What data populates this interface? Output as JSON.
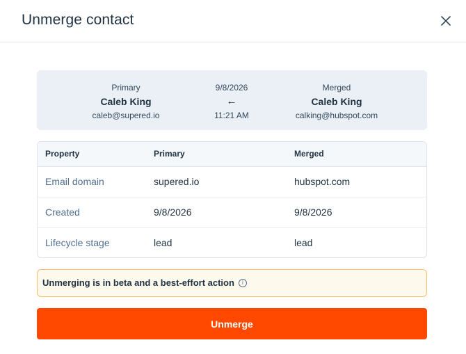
{
  "dialog": {
    "title": "Unmerge contact"
  },
  "summary": {
    "primary": {
      "label": "Primary",
      "name": "Caleb King",
      "email": "caleb@supered.io"
    },
    "middle": {
      "date": "9/8/2026",
      "arrow": "←",
      "time": "11:21 AM"
    },
    "merged": {
      "label": "Merged",
      "name": "Caleb King",
      "email": "calking@hubspot.com"
    }
  },
  "table": {
    "headers": [
      "Property",
      "Primary",
      "Merged"
    ],
    "rows": [
      [
        "Email domain",
        "supered.io",
        "hubspot.com"
      ],
      [
        "Created",
        "9/8/2026",
        "9/8/2026"
      ],
      [
        "Lifecycle stage",
        "lead",
        "lead"
      ]
    ]
  },
  "notice": {
    "text": "Unmerging is in beta and a best-effort action",
    "icon": "info-icon"
  },
  "actions": {
    "unmerge_label": "Unmerge"
  },
  "colors": {
    "accent": "#ff4800",
    "summary_bg": "#eaf0f6",
    "notice_bg": "#fef9ed",
    "notice_border": "#f5c26b"
  }
}
